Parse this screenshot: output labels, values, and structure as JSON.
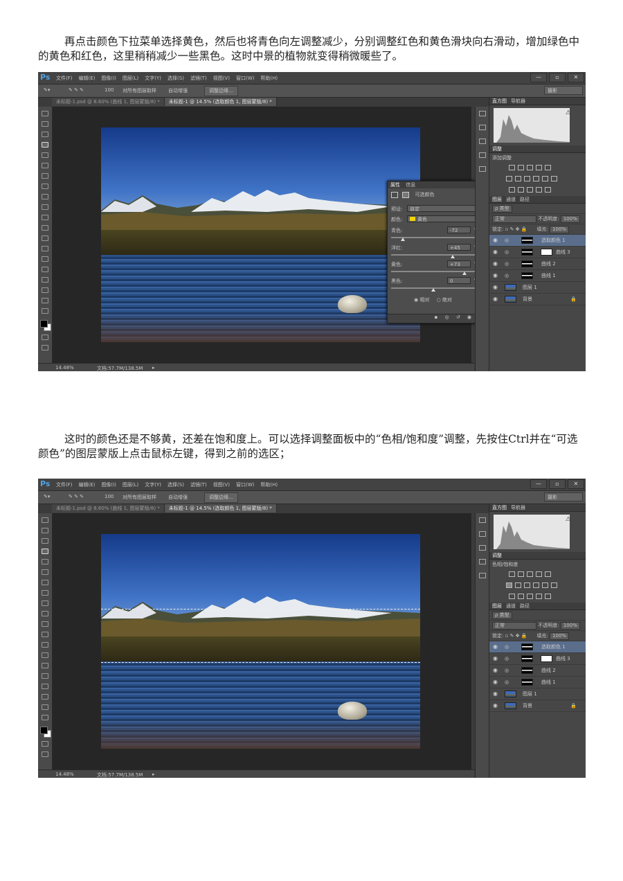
{
  "paragraph1": "再点击颜色下拉菜单选择黄色，然后也将青色向左调整减少，分别调整红色和黄色滑块向右滑动，增加绿色中的黄色和红色，这里稍稍减少一些黑色。这时中景的植物就变得稍微暖些了。",
  "paragraph2": "这时的颜色还是不够黄，还差在饱和度上。可以选择调整面板中的“色相/饱和度”调整，先按住Ctrl并在“可选颜色”的图层蒙版上点击鼠标左键，得到之前的选区；",
  "ps": {
    "logo": "Ps",
    "menu": [
      "文件(F)",
      "编辑(E)",
      "图像(I)",
      "图层(L)",
      "文字(Y)",
      "选择(S)",
      "滤镜(T)",
      "视图(V)",
      "窗口(W)",
      "帮助(H)"
    ],
    "window_buttons": [
      "—",
      "▫",
      "✕"
    ],
    "options": {
      "size": "100",
      "sample_all": "对所有图层取样",
      "auto_enhance": "自动增强",
      "refine_edge": "调整边缘...",
      "workspace": "摄影"
    },
    "tabs": [
      "未标题-1.psd @ 8.60% (曲线 1, 图层蒙版/8) *",
      "未标题-1 @ 14.5% (选取颜色 1, 图层蒙版/8) *"
    ],
    "status": {
      "zoom": "14.48%",
      "doc": "文档:57.7M/138.5M"
    },
    "panel_tabs": {
      "histogram": "直方图",
      "navigator": "导航器",
      "adjust": "调整",
      "layers": "图层",
      "channels": "通道",
      "paths": "路径"
    },
    "layer_controls": {
      "kind": "ρ 类型",
      "blend": "正常",
      "opacity_label": "不透明度:",
      "opacity": "100%",
      "lock_label": "锁定:",
      "fill_label": "填充:",
      "fill": "100%"
    },
    "layers": [
      {
        "name": "选取颜色 1",
        "selected": true,
        "thumb": "adjust"
      },
      {
        "name": "曲线 3",
        "selected": false,
        "thumb": "curve-white"
      },
      {
        "name": "曲线 2",
        "selected": false,
        "thumb": "curve"
      },
      {
        "name": "曲线 1",
        "selected": false,
        "thumb": "curve"
      },
      {
        "name": "图层 1",
        "selected": false,
        "thumb": "photo"
      },
      {
        "name": "背景",
        "selected": false,
        "thumb": "photo",
        "locked": true
      }
    ]
  },
  "screen1": {
    "adjust_subtitle": "添加调整",
    "properties": {
      "tabs": [
        "属性",
        "信息"
      ],
      "title": "可选颜色",
      "preset_label": "预设:",
      "preset": "自定",
      "color_label": "颜色:",
      "color": "黄色",
      "color_swatch": "#f2d40a",
      "sliders": [
        {
          "label": "青色:",
          "value": "-72",
          "pos": 0.14
        },
        {
          "label": "洋红:",
          "value": "+45",
          "pos": 0.73
        },
        {
          "label": "黄色:",
          "value": "+73",
          "pos": 0.87
        },
        {
          "label": "黑色:",
          "value": "0",
          "pos": 0.5
        }
      ],
      "pct": "%",
      "method_relative": "相对",
      "method_absolute": "绝对"
    }
  },
  "screen2": {
    "adjust_subtitle": "色相/饱和度"
  }
}
